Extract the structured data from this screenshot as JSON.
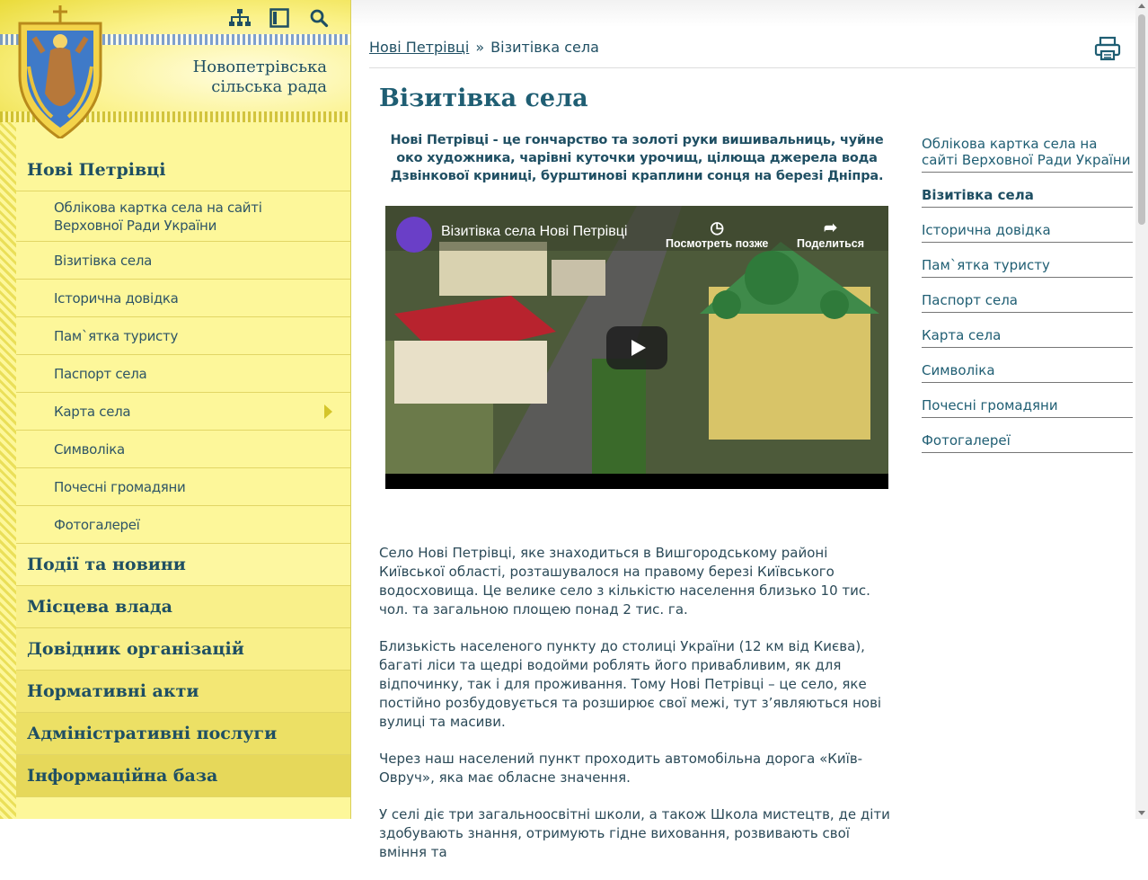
{
  "header": {
    "brand_line1": "Новопетрівська",
    "brand_line2": "сільська рада",
    "icons": [
      "sitemap-icon",
      "layout-icon",
      "search-icon"
    ]
  },
  "sidebar": {
    "section_title": "Нові Петрівці",
    "sub_items": [
      "Облікова картка села на сайті Верховної Ради України",
      "Візитівка села",
      "Історична довідка",
      "Пам`ятка туристу",
      "Паспорт села",
      "Карта села",
      "Символіка",
      "Почесні громадяни",
      "Фотогалереї"
    ],
    "top_items": [
      "Події та новини",
      "Місцева влада",
      "Довідник організацій",
      "Нормативні акти",
      "Адміністративні послуги",
      "Інформаційна база"
    ]
  },
  "breadcrumb": {
    "home": "Нові Петрівці",
    "separator": "»",
    "current": "Візитівка села"
  },
  "page": {
    "title": "Візитівка села",
    "lead": "Нові Петрівці  -  це гончарство та золоті руки вишивальниць, чуйне око художника, чарівні куточки урочищ, цілюща джерела вода Дзвінкової криниці, бурштинові краплини сонця на березі Дніпра.",
    "video": {
      "title": "Візитівка села Нові Петрівці",
      "watch_later": "Посмотреть позже",
      "share": "Поделиться"
    },
    "paragraphs": [
      "Село Нові Петрівці, яке знаходиться в Вишгородському районі Київської області, розташувалося на правому березі Київського водосховища.  Це велике село з кількістю населення близько 10 тис. чол. та загальною площею понад 2 тис. га.",
      "Близькість населеного пункту до столиці України (12 км від Києва), багаті ліси та щедрі водойми роблять його привабливим, як для відпочинку, так і для проживання. Тому Нові Петрівці – це село, яке постійно розбудовується та розширює свої межі, тут з’являються нові вулиці та масиви.",
      "Через наш населений пункт проходить автомобільна дорога «Київ-Овруч», яка має обласне значення.",
      "У селі діє три загальноосвітні школи, а також Школа мистецтв, де діти здобувають знання, отримують гідне виховання, розвивають свої вміння та"
    ]
  },
  "right_nav": [
    "Облікова картка села на сайті Верховної Ради України",
    "Візитівка села",
    "Історична довідка",
    "Пам`ятка туристу",
    "Паспорт села",
    "Карта села",
    "Символіка",
    "Почесні громадяни",
    "Фотогалереї"
  ],
  "colors": {
    "sidebar_bg": "#fdf79a",
    "accent_text": "#1f4f63",
    "title": "#1f5e73"
  }
}
